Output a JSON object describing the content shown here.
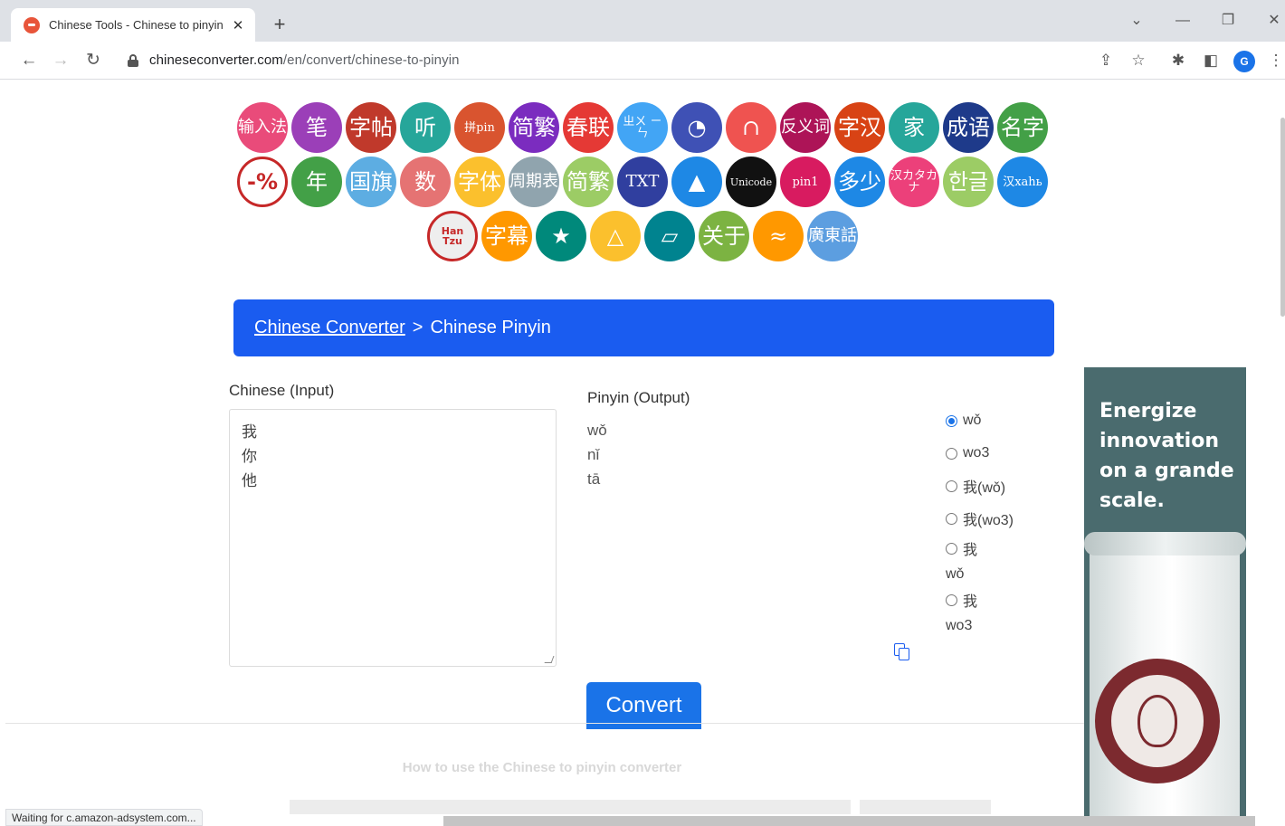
{
  "browser": {
    "tab_title": "Chinese Tools - Chinese to pinyin",
    "url_domain": "chineseconverter.com",
    "url_path": "/en/convert/chinese-to-pinyin",
    "profile_initial": "G",
    "status_text": "Waiting for c.amazon-adsystem.com..."
  },
  "tool_icons": [
    [
      {
        "label": "输入法",
        "color": "#e94b7a"
      },
      {
        "label": "笔",
        "color": "#9b3fb8"
      },
      {
        "label": "字帖",
        "color": "#c0392b"
      },
      {
        "label": "听",
        "color": "#26a69a"
      },
      {
        "label": "拼pin",
        "color": "#d9542f"
      },
      {
        "label": "简繁",
        "color": "#7b2cbf"
      },
      {
        "label": "春联",
        "color": "#e53935"
      },
      {
        "label": "ㄓㄨ ㄧㄣ",
        "color": "#42a5f5"
      },
      {
        "label": "◔",
        "color": "#3f51b5"
      },
      {
        "label": "∩",
        "color": "#ef5350"
      },
      {
        "label": "反义词",
        "color": "#ad1457"
      },
      {
        "label": "字汉",
        "color": "#d84315"
      },
      {
        "label": "家",
        "color": "#26a69a"
      },
      {
        "label": "成语",
        "color": "#1e3a8a"
      },
      {
        "label": "名字",
        "color": "#43a047"
      }
    ],
    [
      {
        "label": "-%",
        "color": "#ffffff"
      },
      {
        "label": "年",
        "color": "#43a047"
      },
      {
        "label": "国旗",
        "color": "#5dade2"
      },
      {
        "label": "数",
        "color": "#e57373"
      },
      {
        "label": "字体",
        "color": "#fbc02d"
      },
      {
        "label": "周期表",
        "color": "#90a4ae"
      },
      {
        "label": "简繁",
        "color": "#9ccc65"
      },
      {
        "label": "TXT",
        "color": "#303f9f"
      },
      {
        "label": "▲",
        "color": "#1e88e5"
      },
      {
        "label": "Unicode",
        "color": "#111111"
      },
      {
        "label": "pin1",
        "color": "#d81b60"
      },
      {
        "label": "多少",
        "color": "#1e88e5"
      },
      {
        "label": "汉カタカナ",
        "color": "#ec407a"
      },
      {
        "label": "한글",
        "color": "#9ccc65"
      },
      {
        "label": "汉xahь",
        "color": "#1e88e5"
      }
    ],
    [
      {
        "label": "Han Tzu",
        "color": "#eeeeee"
      },
      {
        "label": "字幕",
        "color": "#ff9800"
      },
      {
        "label": "★",
        "color": "#00897b"
      },
      {
        "label": "△",
        "color": "#fbc02d"
      },
      {
        "label": "▱",
        "color": "#00838f"
      },
      {
        "label": "关于",
        "color": "#7cb342"
      },
      {
        "label": "≈",
        "color": "#ff9800"
      },
      {
        "label": "廣東話",
        "color": "#5c9ee0"
      }
    ]
  ],
  "breadcrumb": {
    "parent": "Chinese Converter",
    "separator": ">",
    "current": "Chinese Pinyin"
  },
  "input": {
    "label": "Chinese (Input)",
    "lines": [
      "我",
      "你",
      "他"
    ]
  },
  "output": {
    "label": "Pinyin (Output)",
    "lines": [
      "wǒ",
      "nǐ",
      "tā"
    ]
  },
  "format_options": [
    {
      "label": "wǒ",
      "selected": true
    },
    {
      "label": "wo3",
      "selected": false
    },
    {
      "label": "我(wǒ)",
      "selected": false
    },
    {
      "label": "我(wo3)",
      "selected": false
    },
    {
      "label": "我",
      "sub": "wǒ",
      "selected": false
    },
    {
      "label": "我",
      "sub": "wo3",
      "selected": false
    }
  ],
  "convert_label": "Convert",
  "howto_text": "How to use the Chinese to pinyin converter",
  "ad": {
    "headline": "Energize innovation on a grande scale."
  }
}
